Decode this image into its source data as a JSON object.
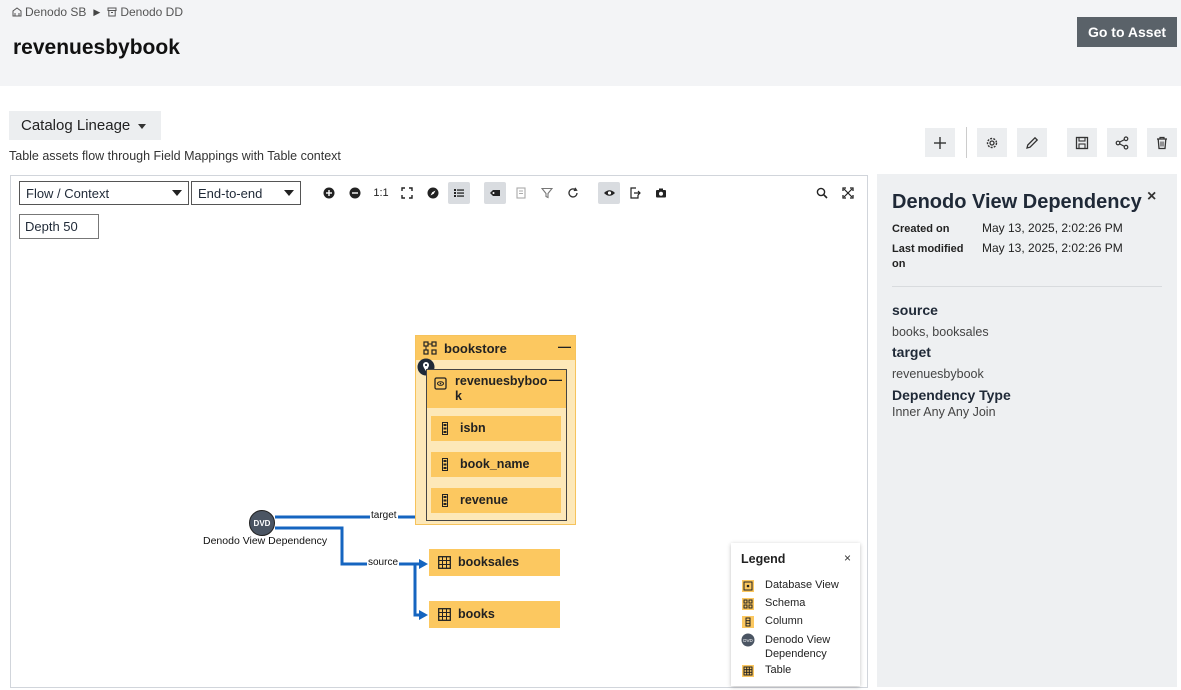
{
  "breadcrumb": {
    "items": [
      {
        "label": "Denodo SB",
        "icon": "database-icon"
      },
      {
        "label": "Denodo DD",
        "icon": "archive-icon"
      }
    ]
  },
  "page_title": "revenuesbybook",
  "header": {
    "goto_label": "Go to Asset"
  },
  "lineage": {
    "dropdown_label": "Catalog Lineage",
    "description": "Table assets flow through Field Mappings with Table context"
  },
  "toolbar": {
    "flow_select": "Flow / Context",
    "scope_select": "End-to-end",
    "depth": "Depth 50",
    "one_to_one": "1:1"
  },
  "graph": {
    "group": {
      "label": "bookstore",
      "icon": "schema-icon"
    },
    "view": {
      "label": "revenuesbybook",
      "icon": "database-view-icon"
    },
    "fields": [
      {
        "label": "isbn",
        "icon": "column-icon"
      },
      {
        "label": "book_name",
        "icon": "column-icon"
      },
      {
        "label": "revenue",
        "icon": "column-icon"
      }
    ],
    "tables": [
      {
        "label": "booksales",
        "icon": "table-icon"
      },
      {
        "label": "books",
        "icon": "table-icon"
      }
    ],
    "dependency": {
      "badge": "DVD",
      "label": "Denodo View Dependency"
    },
    "edges": {
      "target": "target",
      "source": "source"
    }
  },
  "legend": {
    "title": "Legend",
    "close": "×",
    "items": [
      {
        "label": "Database View",
        "icon": "database-view-icon"
      },
      {
        "label": "Schema",
        "icon": "schema-icon"
      },
      {
        "label": "Column",
        "icon": "column-icon"
      },
      {
        "label": "Denodo View Dependency",
        "icon": "dvd-icon"
      },
      {
        "label": "Table",
        "icon": "table-icon"
      }
    ]
  },
  "details": {
    "title": "Denodo View Dependency",
    "close": "×",
    "created_label": "Created on",
    "created_value": "May 13, 2025, 2:02:26 PM",
    "modified_label": "Last modified on",
    "modified_value": "May 13, 2025, 2:02:26 PM",
    "source_label": "source",
    "source_value": "books, booksales",
    "target_label": "target",
    "target_value": "revenuesbybook",
    "dependency_type_label": "Dependency Type",
    "dependency_type_value": "Inner Any Any Join"
  },
  "colors": {
    "node": "#fcc860",
    "group_bg": "#fde8b8",
    "edge": "#1565c0",
    "header_bg": "#f3f4f6",
    "panel_bg": "#eef0f2",
    "goto_bg": "#5a6269"
  }
}
